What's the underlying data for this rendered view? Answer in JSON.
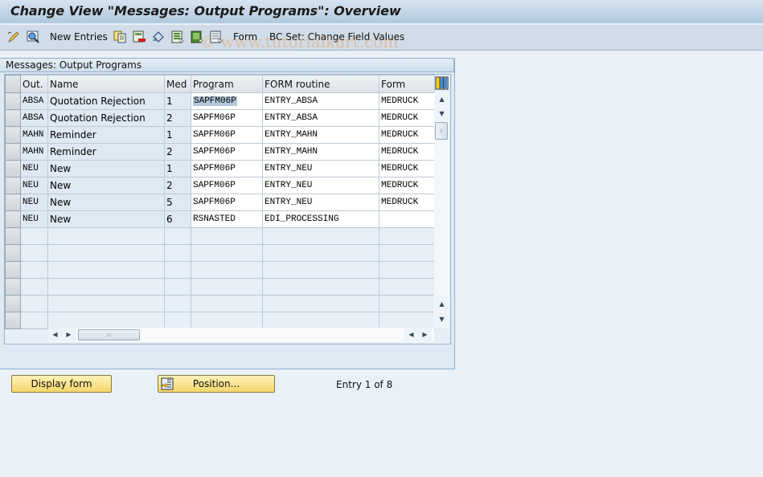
{
  "window": {
    "title": "Change View \"Messages: Output Programs\": Overview"
  },
  "toolbar": {
    "items": [
      {
        "icon": "edit-pencil-icon"
      },
      {
        "icon": "display-change-icon"
      },
      {
        "label": "New Entries"
      },
      {
        "icon": "copy-icon"
      },
      {
        "icon": "delete-icon"
      },
      {
        "icon": "undo-change-icon"
      },
      {
        "icon": "select-all-icon"
      },
      {
        "icon": "select-block-icon"
      },
      {
        "icon": "deselect-all-icon"
      },
      {
        "label": "Form"
      },
      {
        "label": "BC Set: Change Field Values"
      }
    ],
    "new_entries_label": "New Entries",
    "form_label": "Form",
    "bc_set_label": "BC Set: Change Field Values"
  },
  "watermark": "© www.tutorialkart.com",
  "group": {
    "title": "Messages: Output Programs"
  },
  "table": {
    "columns": [
      "Out.",
      "Name",
      "Med",
      "Program",
      "FORM routine",
      "Form"
    ],
    "rows": [
      {
        "out": "ABSA",
        "name": "Quotation Rejection",
        "med": "1",
        "program": "SAPFM06P",
        "routine": "ENTRY_ABSA",
        "form": "MEDRUCK"
      },
      {
        "out": "ABSA",
        "name": "Quotation Rejection",
        "med": "2",
        "program": "SAPFM06P",
        "routine": "ENTRY_ABSA",
        "form": "MEDRUCK"
      },
      {
        "out": "MAHN",
        "name": "Reminder",
        "med": "1",
        "program": "SAPFM06P",
        "routine": "ENTRY_MAHN",
        "form": "MEDRUCK"
      },
      {
        "out": "MAHN",
        "name": "Reminder",
        "med": "2",
        "program": "SAPFM06P",
        "routine": "ENTRY_MAHN",
        "form": "MEDRUCK"
      },
      {
        "out": "NEU",
        "name": "New",
        "med": "1",
        "program": "SAPFM06P",
        "routine": "ENTRY_NEU",
        "form": "MEDRUCK"
      },
      {
        "out": "NEU",
        "name": "New",
        "med": "2",
        "program": "SAPFM06P",
        "routine": "ENTRY_NEU",
        "form": "MEDRUCK"
      },
      {
        "out": "NEU",
        "name": "New",
        "med": "5",
        "program": "SAPFM06P",
        "routine": "ENTRY_NEU",
        "form": "MEDRUCK"
      },
      {
        "out": "NEU",
        "name": "New",
        "med": "6",
        "program": "RSNASTED",
        "routine": "EDI_PROCESSING",
        "form": ""
      }
    ],
    "empty_rows": 6,
    "column_settings_icon": "table-settings-icon"
  },
  "buttons": {
    "display_form": "Display form",
    "position": "Position..."
  },
  "status": {
    "entry_text": "Entry 1 of 8"
  }
}
